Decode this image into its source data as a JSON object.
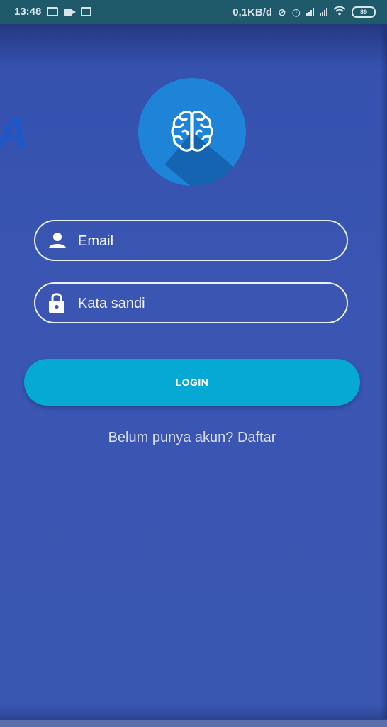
{
  "status_bar": {
    "time": "13:48",
    "network_speed": "0,1KB/d",
    "battery": "89"
  },
  "background": {
    "partial_letter": "A"
  },
  "login": {
    "email_placeholder": "Email",
    "password_placeholder": "Kata sandi",
    "login_label": "LOGIN",
    "register_text": "Belum punya akun? Daftar"
  },
  "icons": {
    "logo": "brain-icon",
    "email": "person-icon",
    "password": "lock-icon"
  },
  "colors": {
    "background": "#3956b1",
    "status_bar": "#1f5a6b",
    "logo_circle": "#1d84d8",
    "button": "#06a9d3",
    "field_border": "#e9eef8"
  }
}
